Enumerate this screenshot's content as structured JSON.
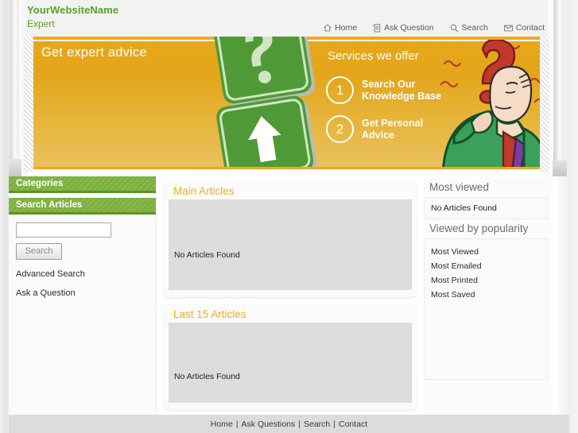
{
  "site": {
    "brand_name": "YourWebsiteName",
    "brand_sub": "Expert",
    "accent_green": "#7cb03d",
    "accent_orange": "#f3b01c",
    "brand_text_color": "#5aa12a"
  },
  "nav": {
    "items": [
      {
        "label": "Home",
        "icon": "home-icon"
      },
      {
        "label": "Ask Question",
        "icon": "document-icon"
      },
      {
        "label": "Search",
        "icon": "search-icon"
      },
      {
        "label": "Contact",
        "icon": "envelope-icon"
      }
    ]
  },
  "banner": {
    "headline": "Get expert advice",
    "services_title": "Services we offer",
    "services": [
      {
        "number": "1",
        "line1": "Search Our",
        "line2": "Knowledge Base"
      },
      {
        "number": "2",
        "line1": "Get Personal",
        "line2": "Advice"
      }
    ],
    "art": {
      "sign_question": "question-mark-road-sign",
      "sign_arrow": "arrow-road-sign",
      "thinker": "thinking-man-illustration",
      "question_mark": "red-question-mark"
    }
  },
  "sidebar_left": {
    "categories_heading": "Categories",
    "search_heading": "Search Articles",
    "search_value": "",
    "search_placeholder": "",
    "search_button": "Search",
    "links": [
      {
        "label": "Advanced Search"
      },
      {
        "label": "Ask a Question"
      }
    ]
  },
  "main": {
    "cards": [
      {
        "title": "Main Articles",
        "empty": "No Articles Found"
      },
      {
        "title": "Last 15 Articles",
        "empty": "No Articles Found"
      }
    ]
  },
  "sidebar_right": {
    "most_viewed_heading": "Most viewed",
    "most_viewed_empty": "No Articles Found",
    "popularity_heading": "Viewed by popularity",
    "popularity_links": [
      {
        "label": "Most Viewed"
      },
      {
        "label": "Most Emailed"
      },
      {
        "label": "Most Printed"
      },
      {
        "label": "Most Saved"
      }
    ]
  },
  "footer": {
    "links": [
      "Home",
      "Ask Questions",
      "Search",
      "Contact"
    ],
    "separator": "|"
  }
}
